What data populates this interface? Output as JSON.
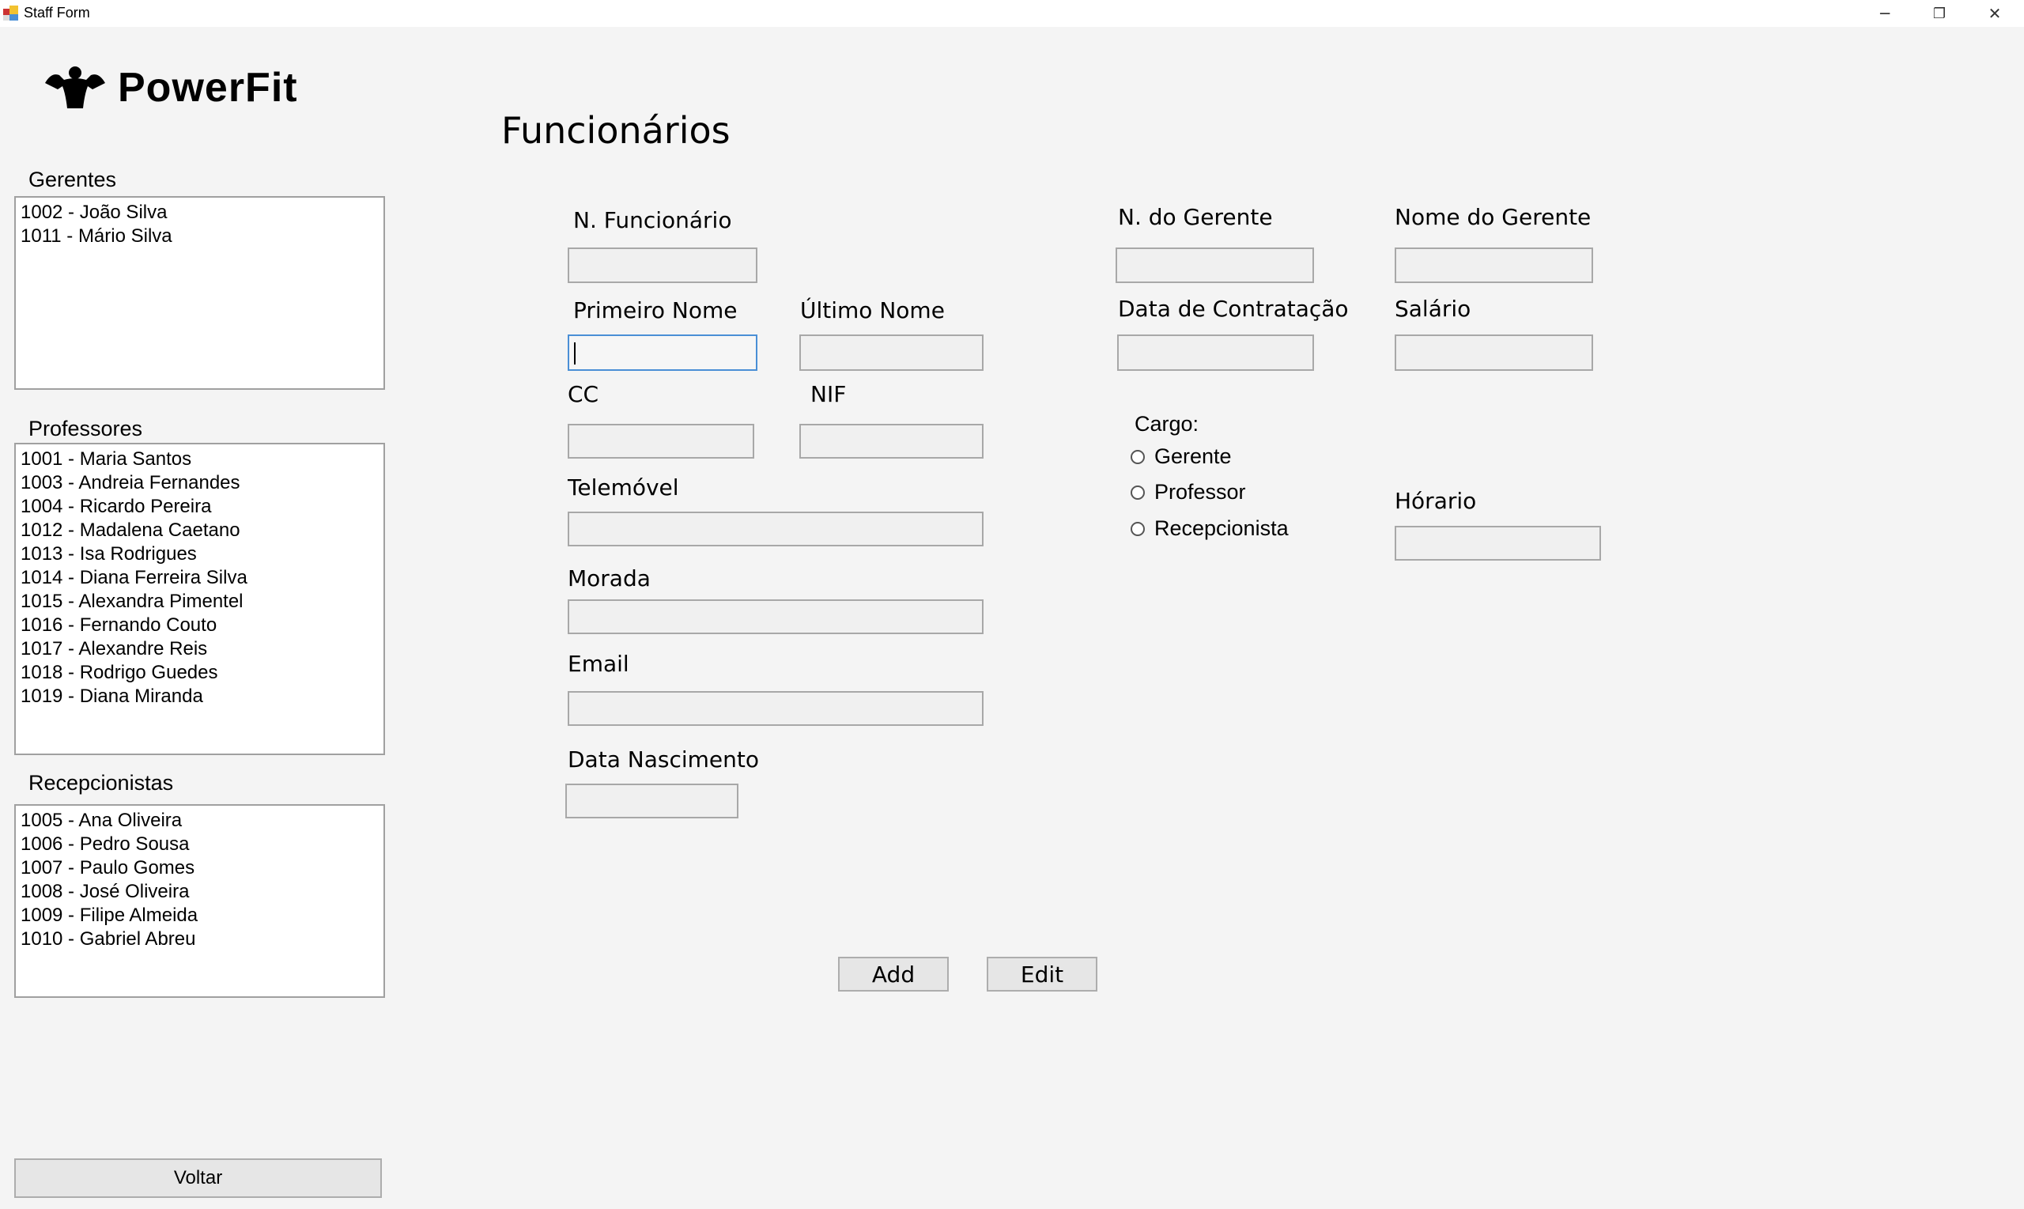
{
  "window": {
    "title": "Staff Form",
    "controls": {
      "minimize": "─",
      "restore": "❐",
      "close": "✕"
    }
  },
  "brand": {
    "name": "PowerFit"
  },
  "page_title": "Funcionários",
  "gerentes": {
    "label": "Gerentes",
    "items": [
      "1002 - João Silva",
      "1011 - Mário Silva"
    ]
  },
  "professores": {
    "label": "Professores",
    "items": [
      "1001 - Maria Santos",
      "1003 - Andreia Fernandes",
      "1004 - Ricardo Pereira",
      "1012 - Madalena Caetano",
      "1013 - Isa Rodrigues",
      "1014 - Diana Ferreira Silva",
      "1015 - Alexandra Pimentel",
      "1016 - Fernando Couto",
      "1017 - Alexandre Reis",
      "1018 - Rodrigo Guedes",
      "1019 - Diana Miranda"
    ]
  },
  "recepcionistas": {
    "label": "Recepcionistas",
    "items": [
      "1005 - Ana Oliveira",
      "1006 - Pedro Sousa",
      "1007 - Paulo Gomes",
      "1008 - José Oliveira",
      "1009 - Filipe Almeida",
      "1010 - Gabriel Abreu"
    ]
  },
  "form": {
    "n_funcionario": "N. Funcionário",
    "primeiro_nome": "Primeiro Nome",
    "ultimo_nome": "Último Nome",
    "cc": "CC",
    "nif": "NIF",
    "telemovel": "Telemóvel",
    "morada": "Morada",
    "email": "Email",
    "data_nascimento": "Data Nascimento",
    "n_gerente": "N. do Gerente",
    "nome_gerente": "Nome do Gerente",
    "data_contratacao": "Data de Contratação",
    "salario": "Salário",
    "cargo": "Cargo:",
    "cargo_options": [
      "Gerente",
      "Professor",
      "Recepcionista"
    ],
    "horario": "Hórario"
  },
  "buttons": {
    "add": "Add",
    "edit": "Edit",
    "voltar": "Voltar"
  }
}
